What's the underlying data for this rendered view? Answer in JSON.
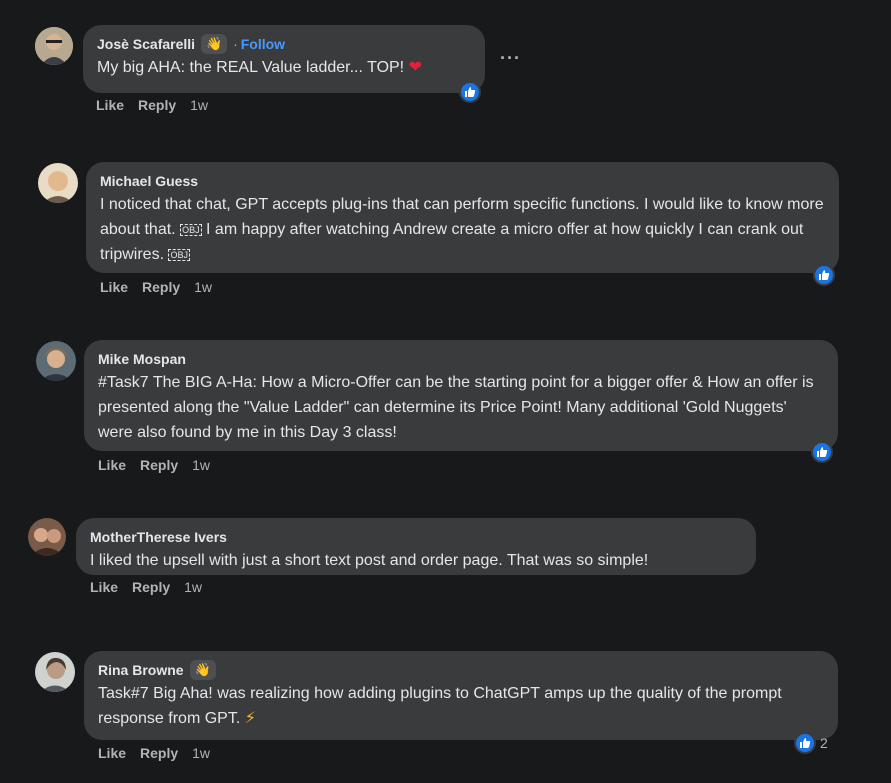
{
  "comments": [
    {
      "author": "Josè Scafarelli",
      "follow_label": "Follow",
      "follow_sep": "·",
      "text": "My big AHA: the REAL Value ladder... TOP!",
      "actions": {
        "like": "Like",
        "reply": "Reply",
        "time": "1w"
      },
      "has_wave_badge": true,
      "reaction": "like-icon"
    },
    {
      "author": "Michael Guess",
      "text_parts": [
        "I noticed that chat, GPT accepts plug-ins that can perform specific functions. I would like to know more about that.",
        " I am happy after watching Andrew create a micro offer at how quickly I can crank out tripwires."
      ],
      "obj_glyph": "OBJ",
      "actions": {
        "like": "Like",
        "reply": "Reply",
        "time": "1w"
      },
      "reaction": "like-icon"
    },
    {
      "author": "Mike Mospan",
      "text": "#Task7 The BIG A-Ha: How a Micro-Offer can be the starting point for a bigger offer & How an offer is presented along the \"Value Ladder\" can determine its Price Point! Many additional 'Gold Nuggets' were also found by me in this Day 3 class!",
      "actions": {
        "like": "Like",
        "reply": "Reply",
        "time": "1w"
      },
      "reaction": "like-icon"
    },
    {
      "author": "MotherTherese Ivers",
      "text": "I liked the upsell with just a short text post and order page. That was so simple!",
      "actions": {
        "like": "Like",
        "reply": "Reply",
        "time": "1w"
      }
    },
    {
      "author": "Rina Browne",
      "text": "Task#7 Big Aha! was realizing how adding plugins to ChatGPT amps up the quality of the prompt response from GPT.",
      "actions": {
        "like": "Like",
        "reply": "Reply",
        "time": "1w"
      },
      "has_wave_badge": true,
      "reaction": "like-icon",
      "reaction_count": "2"
    }
  ],
  "more_menu": "···",
  "colors": {
    "bubble": "#3a3b3c",
    "background": "#18191a",
    "accent": "#1b74e4",
    "heart": "#e41e3f",
    "follow": "#4599ff"
  }
}
